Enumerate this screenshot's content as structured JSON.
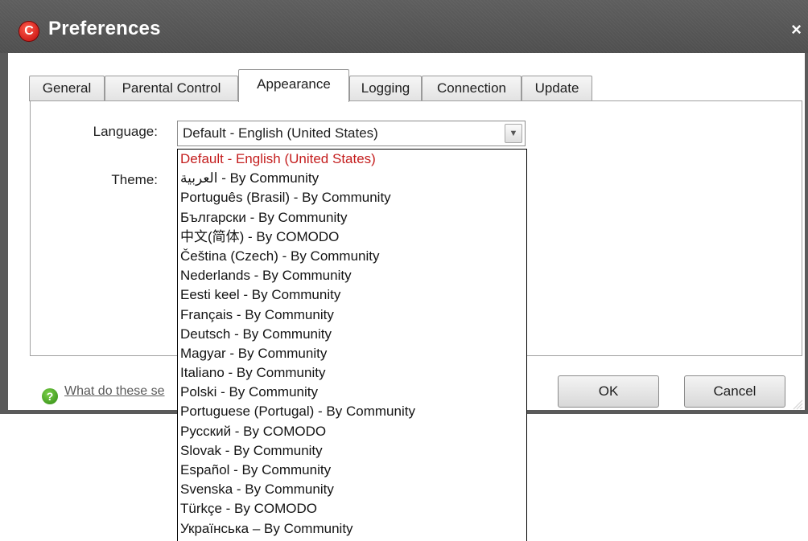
{
  "window": {
    "title": "Preferences",
    "close_glyph": "×"
  },
  "tabs": [
    {
      "label": "General"
    },
    {
      "label": "Parental Control"
    },
    {
      "label": "Appearance",
      "active": true
    },
    {
      "label": "Logging"
    },
    {
      "label": "Connection"
    },
    {
      "label": "Update"
    }
  ],
  "form": {
    "language_label": "Language:",
    "language_value": "Default - English (United States)",
    "theme_label": "Theme:"
  },
  "language_options": [
    "Default - English (United States)",
    "العربية - By Community",
    "Português (Brasil) - By Community",
    "Български - By Community",
    "中文(简体) - By COMODO",
    "Čeština (Czech) - By Community",
    "Nederlands - By Community",
    "Eesti keel - By Community",
    "Français - By Community",
    "Deutsch - By Community",
    "Magyar - By Community",
    "Italiano - By Community",
    "Polski - By Community",
    "Portuguese (Portugal) - By Community",
    "Русский - By COMODO",
    "Slovak - By Community",
    "Español - By Community",
    "Svenska - By Community",
    "Türkçe - By COMODO",
    "Українська – By Community"
  ],
  "footer": {
    "help_text": "What do these se",
    "ok_label": "OK",
    "cancel_label": "Cancel"
  },
  "colors": {
    "selected_option": "#c41e1e",
    "title_bar": "#5a5a5a",
    "app_icon": "#d01010"
  },
  "icons": {
    "app": "comodo-logo-icon",
    "help": "help-question-icon",
    "dropdown": "chevron-down-icon",
    "close": "close-icon"
  }
}
